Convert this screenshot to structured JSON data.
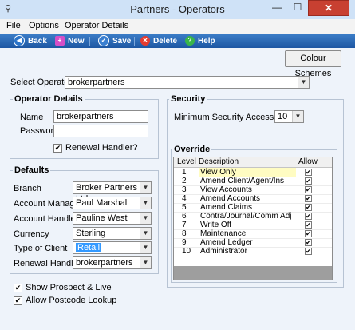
{
  "window": {
    "title": "Partners - Operators"
  },
  "menu": [
    "File",
    "Options",
    "Operator Details"
  ],
  "toolbar": {
    "back": "Back",
    "new": "New",
    "save": "Save",
    "delete": "Delete",
    "help": "Help"
  },
  "colour_schemes_label": "Colour Schemes",
  "select_operator": {
    "label": "Select Operator",
    "value": "brokerpartners"
  },
  "operator_details": {
    "title": "Operator Details",
    "name_label": "Name",
    "name_value": "brokerpartners",
    "password_label": "Password",
    "password_value": "",
    "renewal_handler_label": "Renewal Handler?",
    "renewal_handler_checked": true
  },
  "defaults": {
    "title": "Defaults",
    "fields": [
      {
        "label": "Branch",
        "value": "Broker Partners Ltd"
      },
      {
        "label": "Account Manager",
        "value": "Paul Marshall"
      },
      {
        "label": "Account Handler",
        "value": "Pauline West"
      },
      {
        "label": "Currency",
        "value": "Sterling"
      },
      {
        "label": "Type of Client",
        "value": "Retail"
      },
      {
        "label": "Renewal Handler",
        "value": "brokerpartners"
      }
    ],
    "show_prospect_label": "Show Prospect & Live",
    "allow_postcode_label": "Allow Postcode Lookup"
  },
  "security": {
    "title": "Security",
    "min_level_label": "Minimum Security Access Level",
    "min_level_value": "10"
  },
  "override": {
    "title": "Override",
    "columns": [
      "Level",
      "Description",
      "Allow"
    ],
    "rows": [
      {
        "level": "1",
        "description": "View Only",
        "allow": true
      },
      {
        "level": "2",
        "description": "Amend Client/Agent/Ins",
        "allow": true
      },
      {
        "level": "3",
        "description": "View Accounts",
        "allow": true
      },
      {
        "level": "4",
        "description": "Amend Accounts",
        "allow": true
      },
      {
        "level": "5",
        "description": "Amend Claims",
        "allow": true
      },
      {
        "level": "6",
        "description": "Contra/Journal/Comm Adj",
        "allow": true
      },
      {
        "level": "7",
        "description": "Write Off",
        "allow": true
      },
      {
        "level": "8",
        "description": "Maintenance",
        "allow": true
      },
      {
        "level": "9",
        "description": "Amend Ledger",
        "allow": true
      },
      {
        "level": "10",
        "description": "Administrator",
        "allow": true
      }
    ]
  },
  "colors": {
    "toolbar": "#1d57a3",
    "close": "#c84031",
    "selected_row": "#fffcc2"
  }
}
